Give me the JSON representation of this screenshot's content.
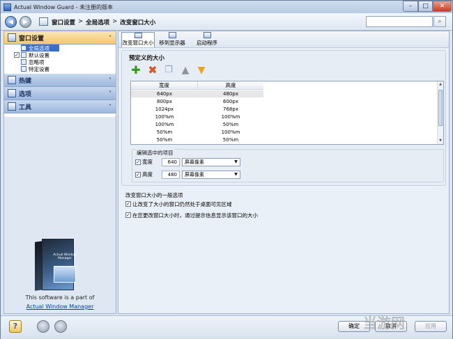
{
  "window": {
    "title": "Actual Window Guard - 未注册的版本"
  },
  "nav": {
    "breadcrumbs": [
      "窗口设置",
      "全局选项",
      "改变窗口大小"
    ],
    "separator": ">",
    "search_placeholder": ""
  },
  "sidebar": {
    "sections": [
      {
        "label": "窗口设置",
        "state": "active",
        "items": [
          {
            "label": "全局选项",
            "checkbox": null,
            "selected": true
          },
          {
            "label": "默认设置",
            "checkbox": "checked",
            "selected": false
          },
          {
            "label": "忽略项",
            "checkbox": null,
            "selected": false
          },
          {
            "label": "特定设置",
            "checkbox": null,
            "selected": false
          }
        ]
      },
      {
        "label": "热键",
        "state": "collapsed"
      },
      {
        "label": "选项",
        "state": "collapsed"
      },
      {
        "label": "工具",
        "state": "collapsed"
      }
    ],
    "promo_text": "This software is a part of",
    "promo_link": "Actual Window Manager",
    "box_title": "Actual Window Manager"
  },
  "tabs": [
    {
      "label": "改变窗口大小",
      "active": true
    },
    {
      "label": "移到显示器",
      "active": false
    },
    {
      "label": "启动程序",
      "active": false
    }
  ],
  "predefined": {
    "title": "预定义的大小",
    "toolbar_icons": [
      "add-icon",
      "delete-icon",
      "copy-icon",
      "move-up-icon",
      "move-down-icon"
    ],
    "columns": [
      "宽度",
      "高度"
    ],
    "rows": [
      [
        "640px",
        "480px"
      ],
      [
        "800px",
        "600px"
      ],
      [
        "1024px",
        "768px"
      ],
      [
        "100%m",
        "100%m"
      ],
      [
        "100%m",
        "50%m"
      ],
      [
        "50%m",
        "100%m"
      ],
      [
        "50%m",
        "50%m"
      ]
    ],
    "selected_row": 0
  },
  "edit": {
    "title": "编辑选中的项目",
    "width_label": "宽度",
    "width_value": "640",
    "width_unit": "屏幕像素",
    "height_label": "高度",
    "height_value": "480",
    "height_unit": "屏幕像素"
  },
  "options": {
    "title": "改变窗口大小的一般选项",
    "opt1": "让改变了大小的窗口仍然处于桌面可见区域",
    "opt2": "在您更改窗口大小时，通过提示信息显示该窗口的大小"
  },
  "buttons": {
    "ok": "确定",
    "cancel": "取消",
    "apply": "应用"
  },
  "watermark": "当游网"
}
